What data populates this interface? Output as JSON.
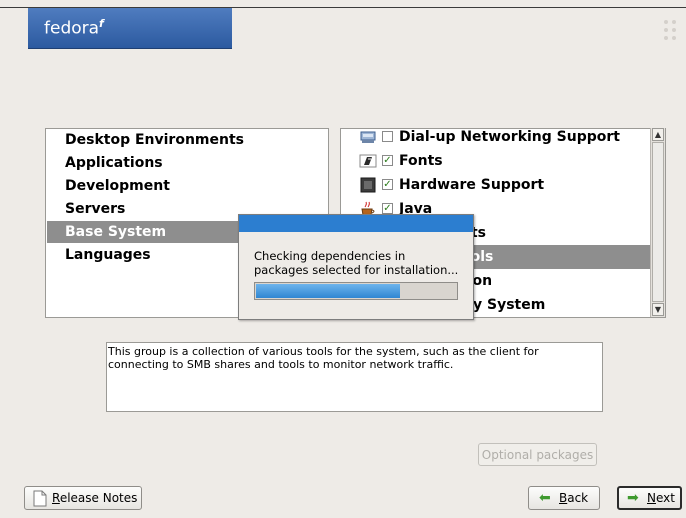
{
  "logo": {
    "text": "fedora",
    "mark": "f"
  },
  "categories": [
    {
      "label": "Desktop Environments",
      "selected": false
    },
    {
      "label": "Applications",
      "selected": false
    },
    {
      "label": "Development",
      "selected": false
    },
    {
      "label": "Servers",
      "selected": false
    },
    {
      "label": "Base System",
      "selected": true
    },
    {
      "label": "Languages",
      "selected": false
    }
  ],
  "packages": [
    {
      "label": "Dial-up Networking Support",
      "checked": false,
      "icon": "modem-icon",
      "selected": false
    },
    {
      "label": "Fonts",
      "checked": true,
      "icon": "font-icon",
      "selected": false
    },
    {
      "label": "Hardware Support",
      "checked": true,
      "icon": "chip-icon",
      "selected": false
    },
    {
      "label": "Java",
      "checked": true,
      "icon": "java-cup-icon",
      "selected": false
    },
    {
      "label": "nts",
      "checked": false,
      "icon": "",
      "selected": false
    },
    {
      "label": "ools",
      "checked": false,
      "icon": "",
      "selected": true
    },
    {
      "label": "tion",
      "checked": false,
      "icon": "",
      "selected": false
    },
    {
      "label": "y System",
      "checked": false,
      "icon": "",
      "selected": false
    }
  ],
  "description": "This group is a collection of various tools for the system, such as the client for connecting to SMB shares and tools to monitor network traffic.",
  "buttons": {
    "optional_packages": "Optional packages",
    "release_notes": "Release Notes",
    "release_notes_mnemonic": "R",
    "back": "Back",
    "back_mnemonic": "B",
    "next": "Next",
    "next_mnemonic": "N"
  },
  "dialog": {
    "message_line1": "Checking dependencies in",
    "message_line2": "packages selected for installation...",
    "progress": 0.72
  },
  "colors": {
    "selection": "#8e8e8e",
    "dialog_title": "#2c7ed0",
    "progress": "#2f86d2"
  }
}
